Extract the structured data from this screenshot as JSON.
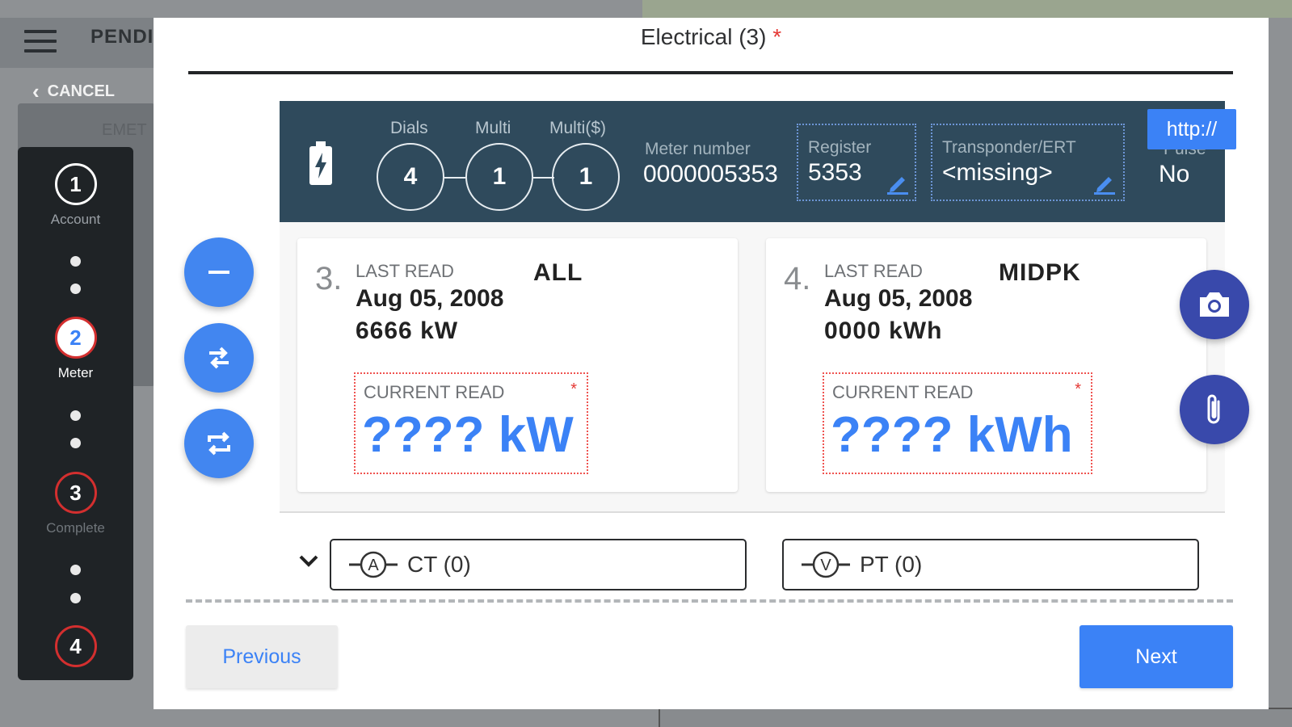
{
  "background": {
    "title": "PENDI",
    "cancel_label": "CANCEL",
    "panel_label": "EMET"
  },
  "stepper": {
    "steps": [
      {
        "number": "1",
        "label": "Account"
      },
      {
        "number": "2",
        "label": "Meter"
      },
      {
        "number": "3",
        "label": "Complete"
      },
      {
        "number": "4",
        "label": ""
      }
    ]
  },
  "modal": {
    "title": "Electrical (3)",
    "required_mark": "*"
  },
  "meter_header": {
    "dials_label": "Dials",
    "dials_value": "4",
    "multi_label": "Multi",
    "multi_value": "1",
    "multi_dollar_label": "Multi($)",
    "multi_dollar_value": "1",
    "meter_number_label": "Meter number",
    "meter_number_value": "0000005353",
    "register_label": "Register",
    "register_value": "5353",
    "transponder_label": "Transponder/ERT",
    "transponder_value": "<missing>",
    "pulse_label": "Pulse",
    "pulse_value": "No",
    "http_label": "http://"
  },
  "registers": [
    {
      "index": "3.",
      "last_read_label": "LAST READ",
      "tou": "ALL",
      "date": "Aug 05, 2008",
      "last_value": "6666 kW",
      "current_label": "CURRENT READ",
      "required_mark": "*",
      "current_value": "???? kW"
    },
    {
      "index": "4.",
      "last_read_label": "LAST READ",
      "tou": "MIDPK",
      "date": "Aug 05, 2008",
      "last_value": "0000 kWh",
      "current_label": "CURRENT READ",
      "required_mark": "*",
      "current_value": "???? kWh"
    }
  ],
  "ct": {
    "label": "CT (0)",
    "symbol": "A"
  },
  "pt": {
    "label": "PT (0)",
    "symbol": "V"
  },
  "footer": {
    "previous_label": "Previous",
    "next_label": "Next"
  },
  "colors": {
    "accent": "#3b82f6",
    "header_bg": "#2f4a5c",
    "required": "#e53935",
    "fab_dark": "#3949ab"
  }
}
